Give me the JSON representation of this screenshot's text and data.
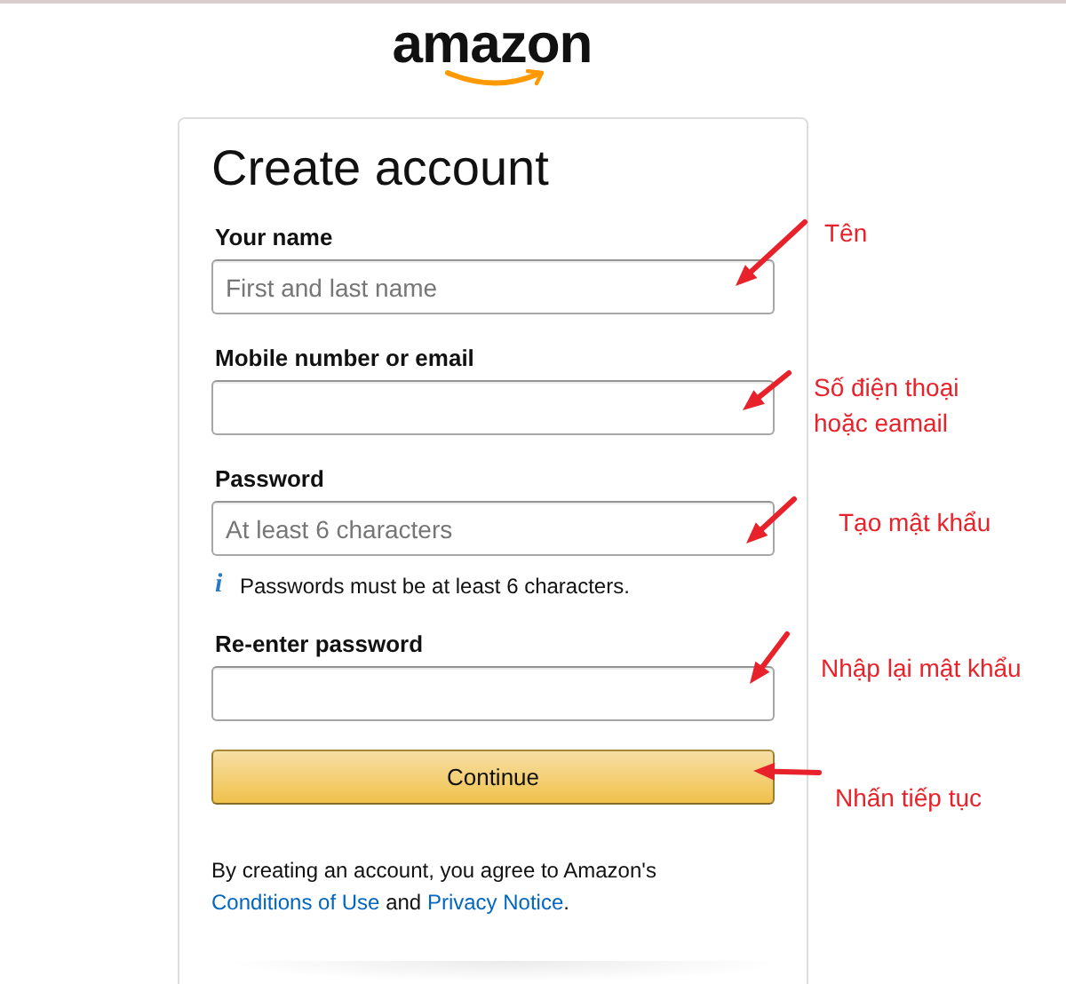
{
  "logo": {
    "text": "amazon"
  },
  "form": {
    "title": "Create account",
    "fields": [
      {
        "label": "Your name",
        "placeholder": "First and last name"
      },
      {
        "label": "Mobile number or email"
      },
      {
        "label": "Password",
        "placeholder": "At least 6 characters",
        "hint": {
          "icon": "i",
          "text": "Passwords must be at least 6 characters."
        }
      },
      {
        "label": "Re-enter password"
      }
    ],
    "submit": "Continue",
    "legal": {
      "prefix": "By creating an account, you agree to Amazon's",
      "links": [
        "Conditions of Use",
        "Privacy Notice"
      ],
      "joiner": "and",
      "suffix": "."
    }
  },
  "annotations": [
    {
      "text": "Tên"
    },
    {
      "text": "Số điện thoại hoặc eamail"
    },
    {
      "text": "Tạo mật khẩu"
    },
    {
      "text": "Nhập lại mật khẩu"
    },
    {
      "text": "Nhấn tiếp tục"
    }
  ]
}
